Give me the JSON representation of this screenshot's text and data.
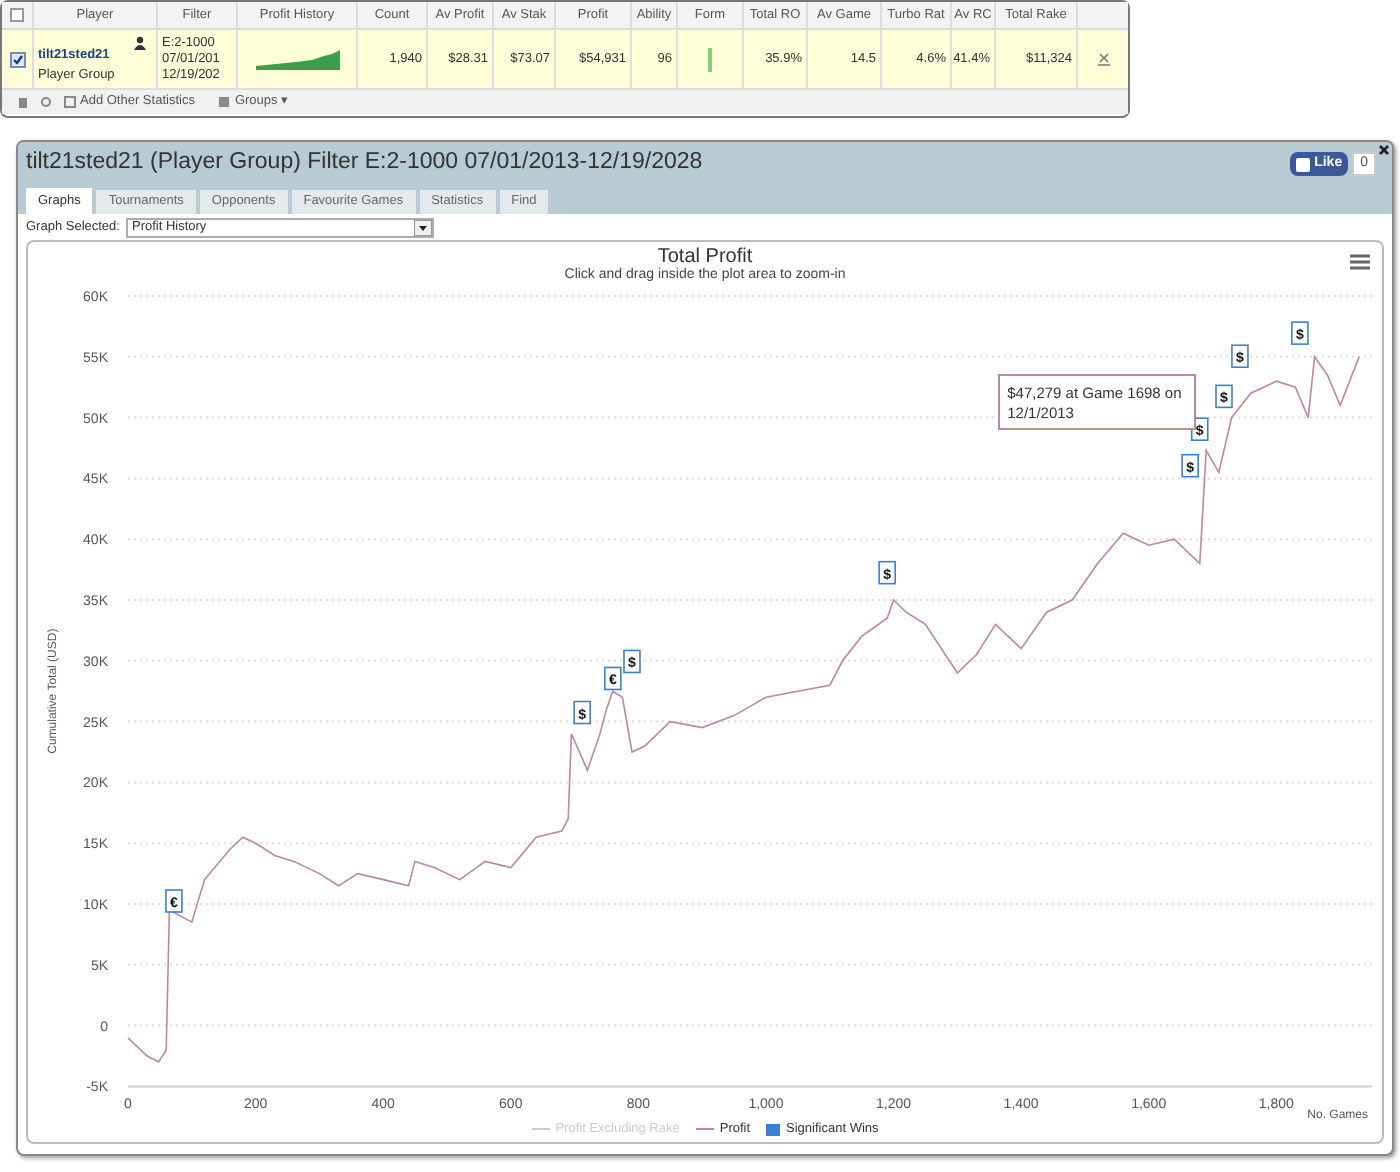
{
  "summary_table": {
    "columns": [
      "Player",
      "Filter",
      "Profit History",
      "Count",
      "Av Profit",
      "Av Stak",
      "Profit",
      "Ability",
      "Form",
      "Total RO",
      "Av Game",
      "Turbo Rat",
      "Av RC",
      "Total Rake"
    ],
    "all_checked": false,
    "row": {
      "checked": true,
      "player": "tilt21sted21",
      "player_type": "Player Group",
      "filter": [
        "E:2-1000",
        "07/01/201",
        "12/19/202"
      ],
      "count": "1,940",
      "av_profit": "$28.31",
      "av_stake": "$73.07",
      "profit": "$54,931",
      "ability": "96",
      "total_ro": "35.9%",
      "av_games": "14.5",
      "turbo_ratio": "4.6%",
      "av_rc": "41.4%",
      "total_rake": "$11,324"
    },
    "footer": {
      "add_stats": "Add Other Statistics",
      "groups": "Groups ▾"
    }
  },
  "window": {
    "title": "tilt21sted21 (Player Group) Filter E:2-1000 07/01/2013-12/19/2028",
    "like": "Like",
    "like_count": "0",
    "tabs": [
      {
        "label": "Graphs",
        "selected": true
      },
      {
        "label": "Tournaments",
        "selected": false
      },
      {
        "label": "Opponents",
        "selected": false
      },
      {
        "label": "Favourite Games",
        "selected": false
      },
      {
        "label": "Statistics",
        "selected": false
      },
      {
        "label": "Find",
        "selected": false
      }
    ],
    "graph_selector": {
      "label": "Graph Selected:",
      "value": "Profit History"
    },
    "chart": {
      "subtitle": "Click and drag inside the plot area to zoom-in",
      "tooltip": {
        "text": "$47,279 at Game 1698 on 12/1/2013"
      },
      "legend": [
        {
          "label": "Profit Excluding Rake",
          "visible": false,
          "kind": "line"
        },
        {
          "label": "Significant Wins",
          "visible": true,
          "kind": "box",
          "color": "#3b7fd0"
        }
      ],
      "chart_data": {
        "type": "line",
        "title": "Total Profit",
        "xlabel": "No. Games",
        "ylabel": "Cumulative Total (USD)",
        "x": [
          0,
          30,
          48,
          60,
          65,
          100,
          120,
          160,
          180,
          200,
          230,
          260,
          300,
          330,
          360,
          400,
          440,
          450,
          480,
          520,
          560,
          600,
          640,
          680,
          690,
          695,
          720,
          740,
          750,
          760,
          775,
          790,
          810,
          850,
          900,
          950,
          1000,
          1050,
          1100,
          1120,
          1150,
          1190,
          1200,
          1220,
          1250,
          1300,
          1330,
          1360,
          1400,
          1440,
          1480,
          1520,
          1560,
          1600,
          1640,
          1680,
          1690,
          1710,
          1730,
          1760,
          1800,
          1830,
          1850,
          1860,
          1880,
          1900,
          1930
        ],
        "series": [
          {
            "name": "Profit",
            "color": "#c08890",
            "values": [
              -1000,
              -2500,
              -3000,
              -2000,
              9500,
              8500,
              12000,
              14500,
              15500,
              15000,
              14000,
              13500,
              12500,
              11500,
              12500,
              12000,
              11500,
              13500,
              13000,
              12000,
              13500,
              13000,
              15500,
              16000,
              17000,
              24000,
              21000,
              24000,
              26000,
              27500,
              27000,
              22500,
              23000,
              25000,
              24500,
              25500,
              27000,
              27500,
              28000,
              30000,
              32000,
              33500,
              35000,
              34000,
              33000,
              29000,
              30500,
              33000,
              31000,
              34000,
              35000,
              38000,
              40500,
              39500,
              40000,
              38000,
              47300,
              45500,
              50000,
              52000,
              53000,
              52500,
              50000,
              55000,
              53500,
              51000,
              55000
            ]
          }
        ],
        "grid": true,
        "xlim": [
          0,
          1950
        ],
        "ylim": [
          -5000,
          60000
        ],
        "xticks": [
          {
            "value": 0,
            "label": "0"
          },
          {
            "value": 200,
            "label": "200"
          },
          {
            "value": 400,
            "label": "400"
          },
          {
            "value": 600,
            "label": "600"
          },
          {
            "value": 800,
            "label": "800"
          },
          {
            "value": 1000,
            "label": "1,000"
          },
          {
            "value": 1200,
            "label": "1,200"
          },
          {
            "value": 1400,
            "label": "1,400"
          },
          {
            "value": 1600,
            "label": "1,600"
          },
          {
            "value": 1800,
            "label": "1,800"
          }
        ],
        "yticks": [
          {
            "value": -5000,
            "label": "-5K"
          },
          {
            "value": 0,
            "label": "0"
          },
          {
            "value": 5000,
            "label": "5K"
          },
          {
            "value": 10000,
            "label": "10K"
          },
          {
            "value": 15000,
            "label": "15K"
          },
          {
            "value": 20000,
            "label": "20K"
          },
          {
            "value": 25000,
            "label": "25K"
          },
          {
            "value": 30000,
            "label": "30K"
          },
          {
            "value": 35000,
            "label": "35K"
          },
          {
            "value": 40000,
            "label": "40K"
          },
          {
            "value": 45000,
            "label": "45K"
          },
          {
            "value": 50000,
            "label": "50K"
          },
          {
            "value": 55000,
            "label": "55K"
          },
          {
            "value": 60000,
            "label": "60K"
          }
        ],
        "annotations": [
          {
            "x": 72,
            "y": 10000,
            "text": "€"
          },
          {
            "x": 712,
            "y": 25500,
            "text": "$"
          },
          {
            "x": 760,
            "y": 28300,
            "text": "€"
          },
          {
            "x": 790,
            "y": 29700,
            "text": "$"
          },
          {
            "x": 1190,
            "y": 37000,
            "text": "$"
          },
          {
            "x": 1665,
            "y": 45800,
            "text": "$"
          },
          {
            "x": 1680,
            "y": 48800,
            "text": "$"
          },
          {
            "x": 1718,
            "y": 51500,
            "text": "$"
          },
          {
            "x": 1743,
            "y": 54800,
            "text": "$"
          },
          {
            "x": 1837,
            "y": 56700,
            "text": "$"
          }
        ]
      }
    }
  }
}
